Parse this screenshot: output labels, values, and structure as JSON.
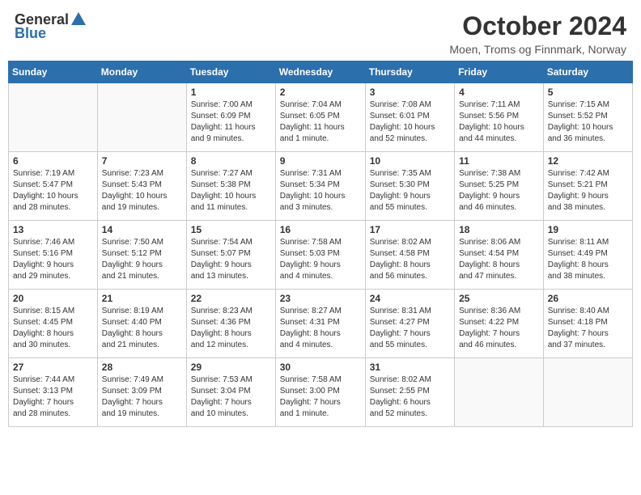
{
  "header": {
    "logo_general": "General",
    "logo_blue": "Blue",
    "month": "October 2024",
    "location": "Moen, Troms og Finnmark, Norway"
  },
  "weekdays": [
    "Sunday",
    "Monday",
    "Tuesday",
    "Wednesday",
    "Thursday",
    "Friday",
    "Saturday"
  ],
  "weeks": [
    [
      {
        "day": "",
        "info": ""
      },
      {
        "day": "",
        "info": ""
      },
      {
        "day": "1",
        "info": "Sunrise: 7:00 AM\nSunset: 6:09 PM\nDaylight: 11 hours\nand 9 minutes."
      },
      {
        "day": "2",
        "info": "Sunrise: 7:04 AM\nSunset: 6:05 PM\nDaylight: 11 hours\nand 1 minute."
      },
      {
        "day": "3",
        "info": "Sunrise: 7:08 AM\nSunset: 6:01 PM\nDaylight: 10 hours\nand 52 minutes."
      },
      {
        "day": "4",
        "info": "Sunrise: 7:11 AM\nSunset: 5:56 PM\nDaylight: 10 hours\nand 44 minutes."
      },
      {
        "day": "5",
        "info": "Sunrise: 7:15 AM\nSunset: 5:52 PM\nDaylight: 10 hours\nand 36 minutes."
      }
    ],
    [
      {
        "day": "6",
        "info": "Sunrise: 7:19 AM\nSunset: 5:47 PM\nDaylight: 10 hours\nand 28 minutes."
      },
      {
        "day": "7",
        "info": "Sunrise: 7:23 AM\nSunset: 5:43 PM\nDaylight: 10 hours\nand 19 minutes."
      },
      {
        "day": "8",
        "info": "Sunrise: 7:27 AM\nSunset: 5:38 PM\nDaylight: 10 hours\nand 11 minutes."
      },
      {
        "day": "9",
        "info": "Sunrise: 7:31 AM\nSunset: 5:34 PM\nDaylight: 10 hours\nand 3 minutes."
      },
      {
        "day": "10",
        "info": "Sunrise: 7:35 AM\nSunset: 5:30 PM\nDaylight: 9 hours\nand 55 minutes."
      },
      {
        "day": "11",
        "info": "Sunrise: 7:38 AM\nSunset: 5:25 PM\nDaylight: 9 hours\nand 46 minutes."
      },
      {
        "day": "12",
        "info": "Sunrise: 7:42 AM\nSunset: 5:21 PM\nDaylight: 9 hours\nand 38 minutes."
      }
    ],
    [
      {
        "day": "13",
        "info": "Sunrise: 7:46 AM\nSunset: 5:16 PM\nDaylight: 9 hours\nand 29 minutes."
      },
      {
        "day": "14",
        "info": "Sunrise: 7:50 AM\nSunset: 5:12 PM\nDaylight: 9 hours\nand 21 minutes."
      },
      {
        "day": "15",
        "info": "Sunrise: 7:54 AM\nSunset: 5:07 PM\nDaylight: 9 hours\nand 13 minutes."
      },
      {
        "day": "16",
        "info": "Sunrise: 7:58 AM\nSunset: 5:03 PM\nDaylight: 9 hours\nand 4 minutes."
      },
      {
        "day": "17",
        "info": "Sunrise: 8:02 AM\nSunset: 4:58 PM\nDaylight: 8 hours\nand 56 minutes."
      },
      {
        "day": "18",
        "info": "Sunrise: 8:06 AM\nSunset: 4:54 PM\nDaylight: 8 hours\nand 47 minutes."
      },
      {
        "day": "19",
        "info": "Sunrise: 8:11 AM\nSunset: 4:49 PM\nDaylight: 8 hours\nand 38 minutes."
      }
    ],
    [
      {
        "day": "20",
        "info": "Sunrise: 8:15 AM\nSunset: 4:45 PM\nDaylight: 8 hours\nand 30 minutes."
      },
      {
        "day": "21",
        "info": "Sunrise: 8:19 AM\nSunset: 4:40 PM\nDaylight: 8 hours\nand 21 minutes."
      },
      {
        "day": "22",
        "info": "Sunrise: 8:23 AM\nSunset: 4:36 PM\nDaylight: 8 hours\nand 12 minutes."
      },
      {
        "day": "23",
        "info": "Sunrise: 8:27 AM\nSunset: 4:31 PM\nDaylight: 8 hours\nand 4 minutes."
      },
      {
        "day": "24",
        "info": "Sunrise: 8:31 AM\nSunset: 4:27 PM\nDaylight: 7 hours\nand 55 minutes."
      },
      {
        "day": "25",
        "info": "Sunrise: 8:36 AM\nSunset: 4:22 PM\nDaylight: 7 hours\nand 46 minutes."
      },
      {
        "day": "26",
        "info": "Sunrise: 8:40 AM\nSunset: 4:18 PM\nDaylight: 7 hours\nand 37 minutes."
      }
    ],
    [
      {
        "day": "27",
        "info": "Sunrise: 7:44 AM\nSunset: 3:13 PM\nDaylight: 7 hours\nand 28 minutes."
      },
      {
        "day": "28",
        "info": "Sunrise: 7:49 AM\nSunset: 3:09 PM\nDaylight: 7 hours\nand 19 minutes."
      },
      {
        "day": "29",
        "info": "Sunrise: 7:53 AM\nSunset: 3:04 PM\nDaylight: 7 hours\nand 10 minutes."
      },
      {
        "day": "30",
        "info": "Sunrise: 7:58 AM\nSunset: 3:00 PM\nDaylight: 7 hours\nand 1 minute."
      },
      {
        "day": "31",
        "info": "Sunrise: 8:02 AM\nSunset: 2:55 PM\nDaylight: 6 hours\nand 52 minutes."
      },
      {
        "day": "",
        "info": ""
      },
      {
        "day": "",
        "info": ""
      }
    ]
  ]
}
